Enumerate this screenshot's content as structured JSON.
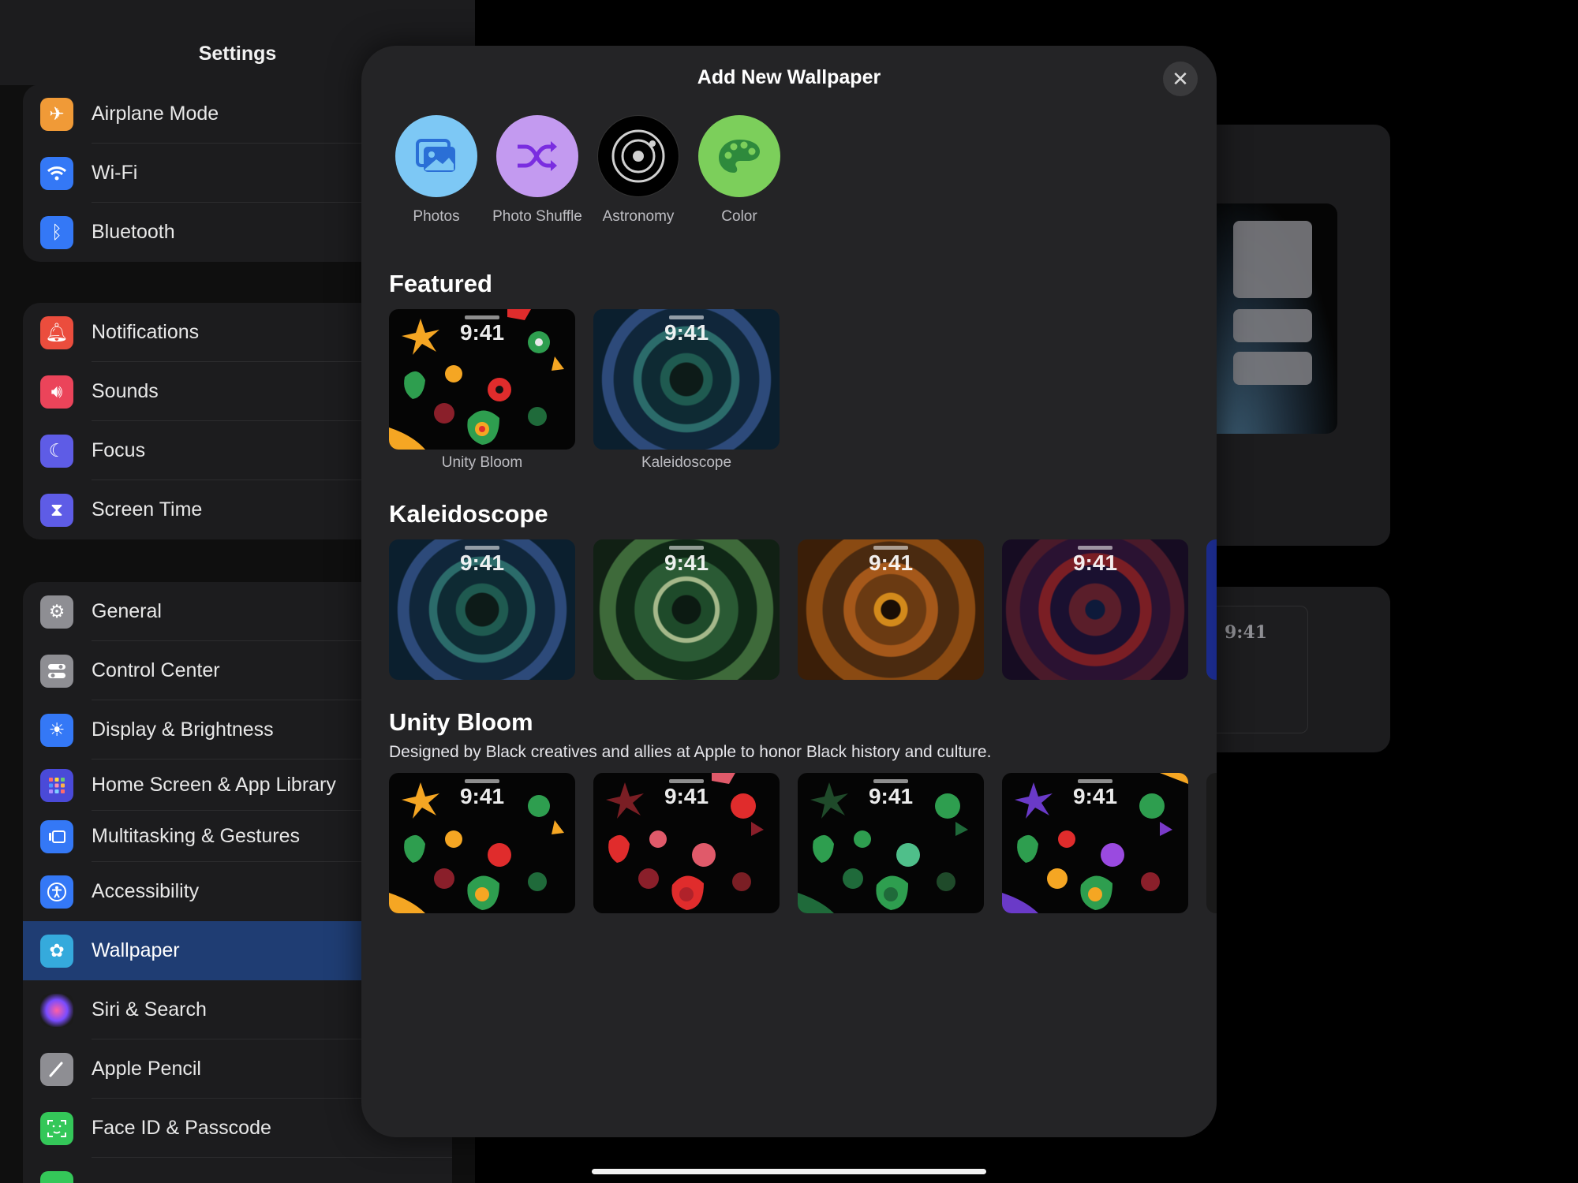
{
  "sidebar": {
    "title": "Settings",
    "groups": [
      [
        {
          "label": "Airplane Mode",
          "icon": "airplane-icon",
          "color": "#f09a37"
        },
        {
          "label": "Wi-Fi",
          "icon": "wifi-icon",
          "color": "#3478f6"
        },
        {
          "label": "Bluetooth",
          "icon": "bluetooth-icon",
          "color": "#3478f6"
        }
      ],
      [
        {
          "label": "Notifications",
          "icon": "bell-icon",
          "color": "#eb4d3d"
        },
        {
          "label": "Sounds",
          "icon": "speaker-icon",
          "color": "#eb445a"
        },
        {
          "label": "Focus",
          "icon": "moon-icon",
          "color": "#5e5ce6"
        },
        {
          "label": "Screen Time",
          "icon": "hourglass-icon",
          "color": "#5e5ce6"
        }
      ],
      [
        {
          "label": "General",
          "icon": "gear-icon",
          "color": "#8e8e93"
        },
        {
          "label": "Control Center",
          "icon": "toggles-icon",
          "color": "#8e8e93"
        },
        {
          "label": "Display & Brightness",
          "icon": "sun-icon",
          "color": "#3478f6"
        },
        {
          "label": "Home Screen & App Library",
          "icon": "app-grid-icon",
          "color": "#4a4ad8"
        },
        {
          "label": "Multitasking & Gestures",
          "icon": "multitasking-icon",
          "color": "#3478f6"
        },
        {
          "label": "Accessibility",
          "icon": "accessibility-icon",
          "color": "#3478f6"
        },
        {
          "label": "Wallpaper",
          "icon": "flower-icon",
          "color": "#35aadc",
          "selected": true
        },
        {
          "label": "Siri & Search",
          "icon": "siri-icon",
          "color": "#222"
        },
        {
          "label": "Apple Pencil",
          "icon": "pencil-icon",
          "color": "#8e8e93"
        },
        {
          "label": "Face ID & Passcode",
          "icon": "face-id-icon",
          "color": "#34c759"
        }
      ]
    ]
  },
  "detail": {
    "lock_preview_time": "9:41"
  },
  "sheet": {
    "title": "Add New Wallpaper",
    "close_icon": "close-icon",
    "sources": [
      {
        "label": "Photos",
        "icon": "photos-icon",
        "color": "#7dc8f5"
      },
      {
        "label": "Photo Shuffle",
        "icon": "shuffle-icon",
        "color": "#c39af0"
      },
      {
        "label": "Astronomy",
        "icon": "astronomy-icon",
        "color": "#000000"
      },
      {
        "label": "Color",
        "icon": "palette-icon",
        "color": "#7ccf5b"
      }
    ],
    "featured": {
      "title": "Featured",
      "items": [
        {
          "caption": "Unity Bloom",
          "time": "9:41"
        },
        {
          "caption": "Kaleidoscope",
          "time": "9:41"
        }
      ]
    },
    "kaleidoscope": {
      "title": "Kaleidoscope",
      "times": [
        "9:41",
        "9:41",
        "9:41",
        "9:41"
      ]
    },
    "unity_bloom": {
      "title": "Unity Bloom",
      "description": "Designed by Black creatives and allies at Apple to honor Black history and culture.",
      "times": [
        "9:41",
        "9:41",
        "9:41",
        "9:41"
      ]
    }
  }
}
